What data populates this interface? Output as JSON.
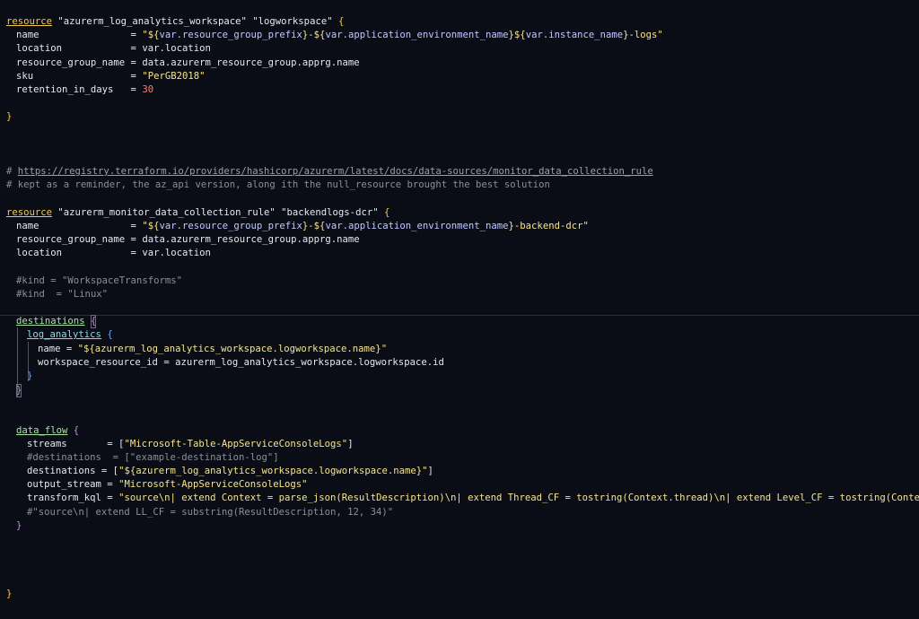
{
  "editor": {
    "lines": {
      "l1_kw": "resource",
      "l1_rest1": " ",
      "l1_s1": "\"azurerm_log_analytics_workspace\"",
      "l1_s2": " \"logworkspace\" ",
      "l1_brace": "{",
      "l2_key": "name                = ",
      "l2_q1": "\"${",
      "l2_v1": "var.resource_group_prefix",
      "l2_m1": "}-${",
      "l2_v2": "var.application_environment_name",
      "l2_m2": "}${",
      "l2_v3": "var.instance_name",
      "l2_m3": "}-logs\"",
      "l3": "location            = var.location",
      "l4": "resource_group_name = data.azurerm_resource_group.apprg.name",
      "l5_key": "sku                 = ",
      "l5_val": "\"PerGB2018\"",
      "l6_key": "retention_in_days   = ",
      "l6_val": "30",
      "l7": "}",
      "c1_hash": "# ",
      "c1_url": "https://registry.terraform.io/providers/hashicorp/azurerm/latest/docs/data-sources/monitor_data_collection_rule",
      "c2": "# kept as a reminder, the az_api version, along ith the null_resource brought the best solution",
      "r2_kw": "resource",
      "r2_s1": " \"azurerm_monitor_data_collection_rule\" \"backendlogs-dcr\" ",
      "r2_brace": "{",
      "r2_name_key": "name                = ",
      "r2_q1": "\"${",
      "r2_v1": "var.resource_group_prefix",
      "r2_m1": "}-${",
      "r2_v2": "var.application_environment_name",
      "r2_m2": "}-backend-dcr\"",
      "r2_rg": "resource_group_name = data.azurerm_resource_group.apprg.name",
      "r2_loc": "location            = var.location",
      "kind1": "#kind = \"WorkspaceTransforms\"",
      "kind2": "#kind  = \"Linux\"",
      "dest_kw": "destinations",
      "dest_brace": "{",
      "la_kw": "log_analytics",
      "la_brace": "{",
      "la_name_key": "name = ",
      "la_name_val": "\"${azurerm_log_analytics_workspace.logworkspace.name}\"",
      "la_wsid": "workspace_resource_id = azurerm_log_analytics_workspace.logworkspace.id",
      "la_close": "}",
      "dest_close": "}",
      "df_kw": "data_flow",
      "df_brace": "{",
      "df_streams_key": "streams       = [",
      "df_streams_val": "\"Microsoft-Table-AppServiceConsoleLogs\"",
      "df_streams_end": "]",
      "df_dest_cmt": "#destinations  = [\"example-destination-log\"]",
      "df_dest_key": "destinations = [",
      "df_dest_val": "\"${azurerm_log_analytics_workspace.logworkspace.name}\"",
      "df_dest_end": "]",
      "df_out_key": "output_stream = ",
      "df_out_val": "\"Microsoft-AppServiceConsoleLogs\"",
      "df_kql_key": "transform_kql = ",
      "df_kql_val": "\"source\\n| extend Context = parse_json(ResultDescription)\\n| extend Thread_CF = tostring(Context.thread)\\n| extend Level_CF = tostring(Context.level)",
      "df_kql_cmt": "#\"source\\n| extend LL_CF = substring(ResultDescription, 12, 34)\"",
      "df_close": "}",
      "final_close": "}"
    }
  }
}
